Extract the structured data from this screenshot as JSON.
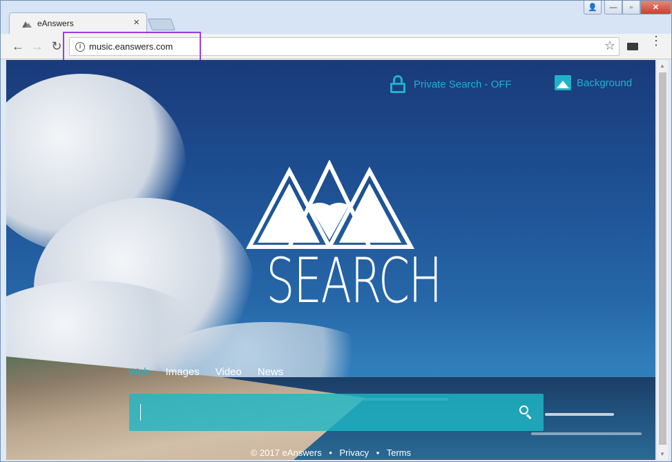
{
  "browser": {
    "tab_title": "eAnswers",
    "tab_close": "×",
    "url": "music.eanswers.com",
    "window_controls": {
      "user": "👤",
      "minimize": "—",
      "maximize": "▫",
      "close": "✕"
    },
    "nav": {
      "back": "←",
      "forward": "→",
      "reload": "↻",
      "star": "☆",
      "menu": "⋮"
    }
  },
  "page": {
    "top_links": {
      "private_search": "Private Search - OFF",
      "background": "Background"
    },
    "logo_text": "SEARCH",
    "search_tabs": [
      {
        "label": "Web",
        "active": true
      },
      {
        "label": "Images",
        "active": false
      },
      {
        "label": "Video",
        "active": false
      },
      {
        "label": "News",
        "active": false
      }
    ],
    "search_input_value": "",
    "footer": {
      "copyright": "© 2017 eAnswers",
      "privacy": "Privacy",
      "terms": "Terms",
      "separator": "•"
    }
  },
  "colors": {
    "accent": "#1fb3c9",
    "highlight_box": "#9b3de0"
  },
  "icons": [
    "info-icon",
    "star-icon",
    "menu-icon",
    "lock-icon",
    "image-icon",
    "search-icon"
  ]
}
